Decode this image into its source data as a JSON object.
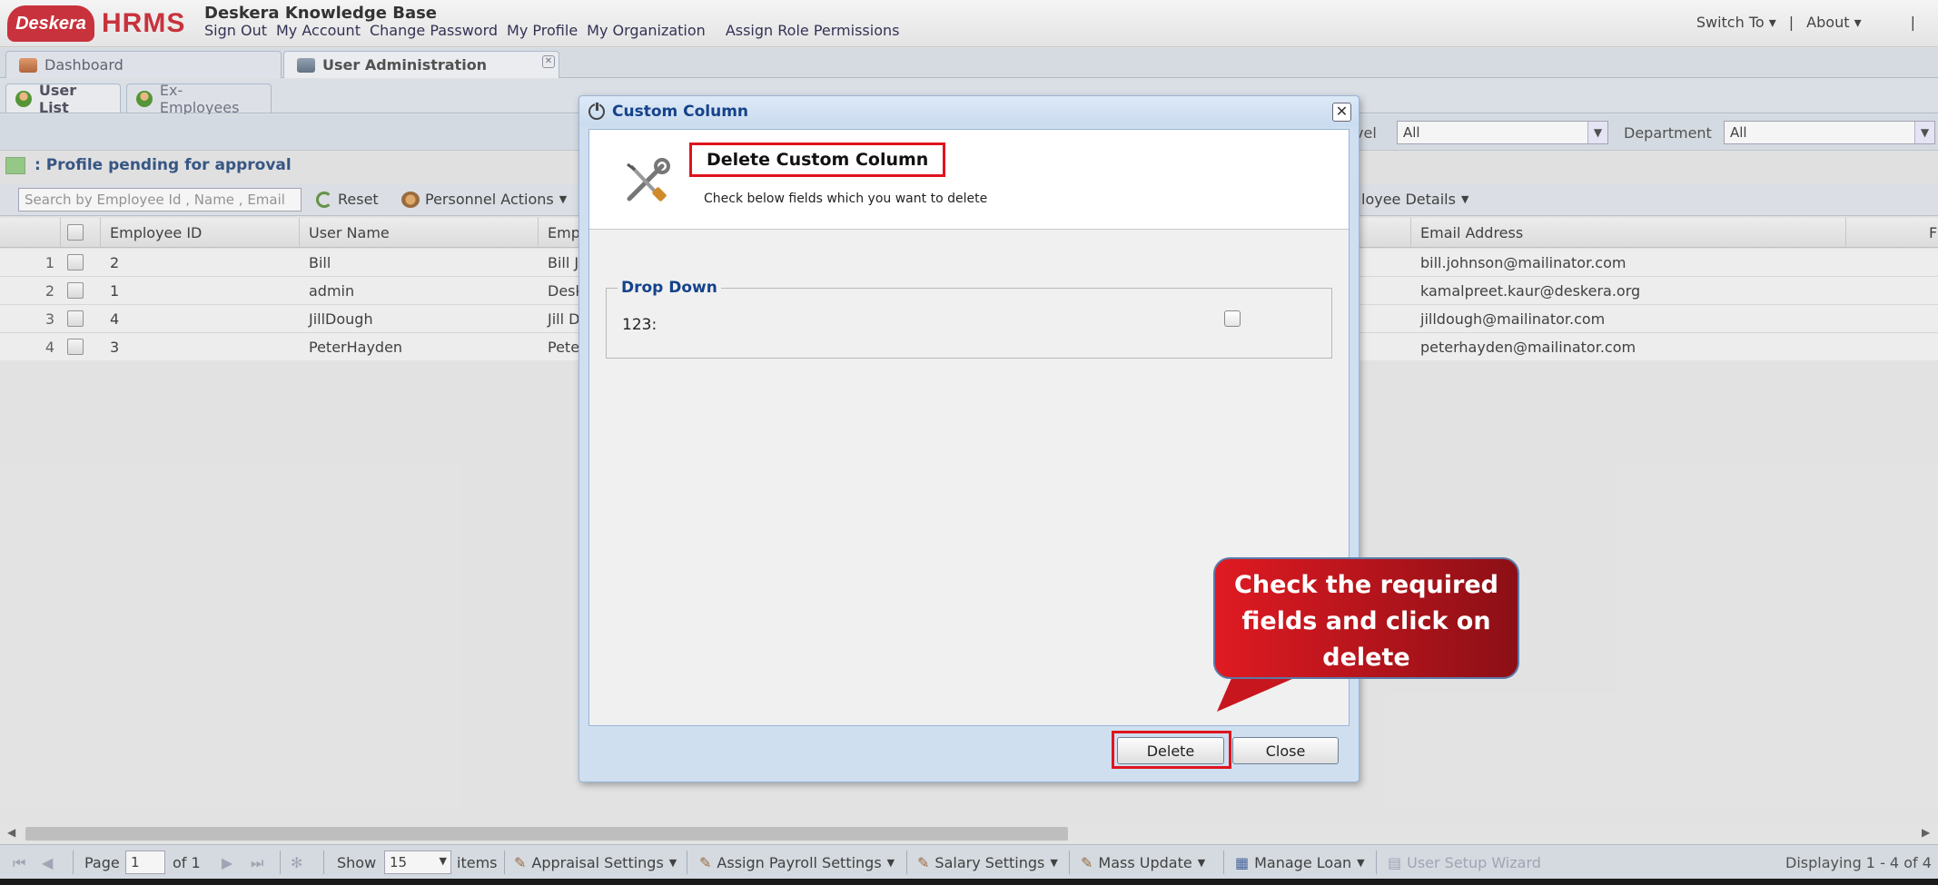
{
  "header": {
    "logo_cloud": "Deskera",
    "logo_text": "HRMS",
    "company": "Deskera Knowledge Base",
    "nav": [
      "Sign Out",
      "My Account",
      "Change Password",
      "My Profile",
      "My Organization"
    ],
    "assign_role": "Assign Role Permissions",
    "switch_to": "Switch To",
    "about": "About"
  },
  "main_tabs": [
    {
      "label": "Dashboard"
    },
    {
      "label": "User Administration"
    }
  ],
  "sub_tabs": [
    {
      "label": "User List"
    },
    {
      "label": "Ex-Employees"
    }
  ],
  "filters": {
    "level_label": "vel",
    "level_value": "All",
    "department_label": "Department",
    "department_value": "All"
  },
  "legend_text": ": Profile pending for approval",
  "toolbar": {
    "search_placeholder": "Search by Employee Id , Name , Email",
    "reset": "Reset",
    "personnel_actions": "Personnel Actions",
    "employee_details": "loyee Details"
  },
  "grid": {
    "columns": {
      "employee_id": "Employee ID",
      "user_name": "User Name",
      "emp": "Emp",
      "email": "Email Address",
      "last": "F"
    },
    "rows": [
      {
        "num": "1",
        "id": "2",
        "user": "Bill",
        "name": "Bill J",
        "email": "bill.johnson@mailinator.com"
      },
      {
        "num": "2",
        "id": "1",
        "user": "admin",
        "name": "Desk",
        "email": "kamalpreet.kaur@deskera.org"
      },
      {
        "num": "3",
        "id": "4",
        "user": "JillDough",
        "name": "Jill D",
        "email": "jilldough@mailinator.com"
      },
      {
        "num": "4",
        "id": "3",
        "user": "PeterHayden",
        "name": "Pete",
        "email": "peterhayden@mailinator.com"
      }
    ]
  },
  "pagination": {
    "page_label": "Page",
    "page_value": "1",
    "of_label": "of 1",
    "show_label": "Show",
    "show_value": "15",
    "items_label": "items",
    "appraisal": "Appraisal Settings",
    "payroll": "Assign Payroll Settings",
    "salary": "Salary Settings",
    "mass_update": "Mass Update",
    "manage_loan": "Manage Loan",
    "user_setup": "User Setup Wizard",
    "displaying": "Displaying 1 - 4 of 4"
  },
  "modal": {
    "title": "Custom Column",
    "header_title": "Delete Custom Column",
    "header_desc": "Check below fields which you want to delete",
    "section": "Drop Down",
    "field_label": "123:",
    "delete_label": "Delete",
    "close_label": "Close"
  },
  "callout": {
    "text": "Check the required fields and click on delete"
  },
  "colors": {
    "accent_red": "#e0141e",
    "title_blue": "#15428b",
    "brand_red": "#c8323c"
  }
}
